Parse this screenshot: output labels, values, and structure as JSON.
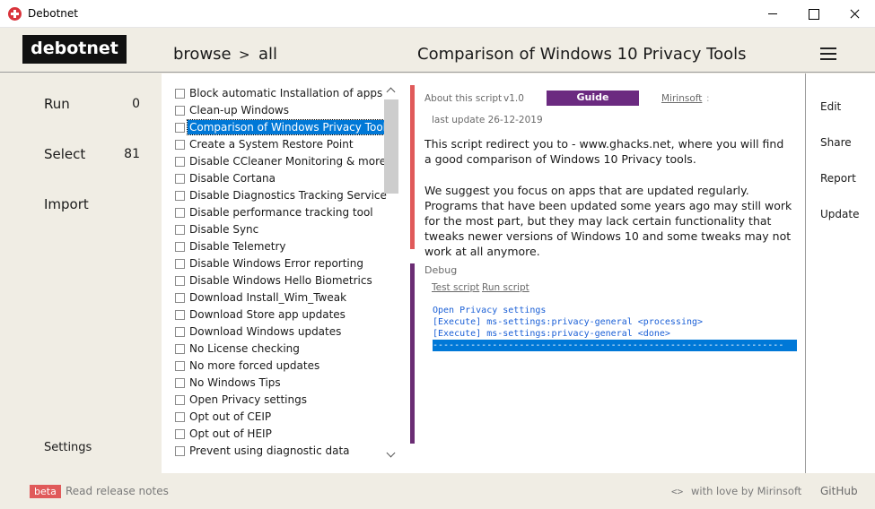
{
  "window": {
    "title": "Debotnet"
  },
  "header": {
    "logo": "debotnet",
    "breadcrumb": [
      "browse",
      ">",
      "all"
    ],
    "page_title": "Comparison of Windows 10 Privacy Tools",
    "menu_icon": "hamburger-icon"
  },
  "left_nav": {
    "items": [
      {
        "label": "Run",
        "count": "0"
      },
      {
        "label": "Select",
        "count": "81"
      },
      {
        "label": "Import",
        "count": ""
      }
    ],
    "settings": "Settings"
  },
  "script_list": {
    "selected_index": 2,
    "items": [
      "Block automatic Installation of apps",
      "Clean-up Windows",
      "Comparison of Windows Privacy Tools",
      "Create a System Restore Point",
      "Disable CCleaner Monitoring & more",
      "Disable Cortana",
      "Disable Diagnostics Tracking Service",
      "Disable performance tracking tool",
      "Disable Sync",
      "Disable Telemetry",
      "Disable Windows Error reporting",
      "Disable Windows Hello Biometrics",
      "Download Install_Wim_Tweak",
      "Download Store app updates",
      "Download Windows updates",
      "No License checking",
      "No more forced updates",
      "No Windows Tips",
      "Open Privacy settings",
      "Opt out of CEIP",
      "Opt out of HEIP",
      "Prevent using diagnostic data"
    ]
  },
  "about": {
    "label": "About this script",
    "version": "v1.0",
    "guide_button": "Guide",
    "author": "Mirinsoft",
    "author_suffix": ":",
    "last_update": "last update 26-12-2019",
    "description_1": "This script redirect you to - www.ghacks.net, where you will find a good comparison of Windows 10 Privacy tools.",
    "description_2": "We suggest you focus on apps that are updated regularly. Programs that have been updated some years ago may still work for the most part, but they may lack certain functionality that tweaks newer versions of Windows 10 and some tweaks may not work at all anymore."
  },
  "debug": {
    "label": "Debug",
    "test_link": "Test script",
    "run_link": "Run script",
    "console_lines": [
      "Open Privacy settings",
      "[Execute] ms-settings:privacy-general <processing>",
      "[Execute] ms-settings:privacy-general <done>",
      "-----------------------------------------------------------------"
    ]
  },
  "right_nav": {
    "items": [
      "Edit",
      "Share",
      "Report",
      "Update"
    ]
  },
  "footer": {
    "beta_badge": "beta",
    "release_notes": "Read release notes",
    "code_icon": "<>",
    "love": "with love by Mirinsoft",
    "github": "GitHub"
  },
  "colors": {
    "accent_red": "#e05a5a",
    "accent_purple": "#6b2d74",
    "selection_blue": "#0078d7",
    "background": "#f0ede4"
  }
}
